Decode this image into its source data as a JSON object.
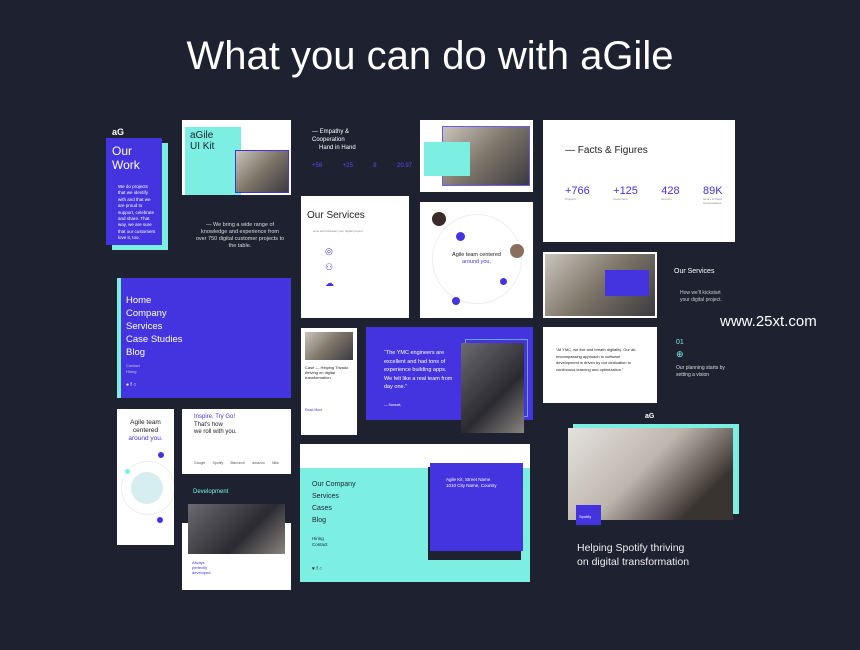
{
  "title": "What you can do with aGile",
  "watermark": "www.25xt.com",
  "our_work": {
    "logo": "aG",
    "heading": "Our Work",
    "body": "We do projects that we identify with and that we are proud to support, celebrate and share. That way, we are sure that our customers love it, too."
  },
  "ui_kit": {
    "logo": "aG",
    "heading_1": "aGile",
    "heading_2": "UI Kit"
  },
  "empathy": {
    "line1": "— Empathy &",
    "line2": "Cooperation",
    "line3": "Hand in Hand",
    "stats": [
      "+56",
      "+25",
      "8",
      "20.97"
    ]
  },
  "bring": {
    "text": "— We bring a wide range of knowledge and experience from over 750 digital customer projects to the table."
  },
  "our_services_card": {
    "heading": "Our Services",
    "sub": "How we'll kickstart your digital project."
  },
  "facts": {
    "heading": "— Facts & Figures",
    "items": [
      {
        "value": "+766",
        "label": "Projects"
      },
      {
        "value": "+125",
        "label": "Customers"
      },
      {
        "value": "428",
        "label": "Servers"
      },
      {
        "value": "89K",
        "label": "Hours of client conversations"
      }
    ]
  },
  "team_circle": {
    "line1": "Agile team centered",
    "line2": "around you."
  },
  "services_side": {
    "heading": "Our Services",
    "line1": "How we'll kickstart",
    "line2": "your digital project."
  },
  "menu": {
    "items": [
      "Home",
      "Company",
      "Services",
      "Case Studies",
      "Blog"
    ],
    "small": [
      "Contact",
      "Hiring"
    ]
  },
  "case": {
    "title": "Case — Helping Trivado thriving on digital transformation",
    "link": "Read More"
  },
  "quote": {
    "text": "“The YMC engineers are excellent and had tons of experience building apps. We felt like a real team from day one.”",
    "author": "— Samuel,"
  },
  "ymc": {
    "text": "“At YMC, we live and breath digitality. Our all-encompassing approach to software development is driven by our dedication to continuous learning and optimization.”"
  },
  "step": {
    "number": "01",
    "text": "Our planning starts by setting a vision"
  },
  "phone": {
    "line1": "Agile team",
    "line2": "centered",
    "line3": "around you."
  },
  "inspire": {
    "line1": "Inspire, Try Go!",
    "line2": "That's how",
    "line3": "we roll with you.",
    "logos": [
      "Google",
      "Spotify",
      "Bitcrunch",
      "amazon",
      "Nike"
    ]
  },
  "development": {
    "label": "Development",
    "heading": "Always perfectly developed"
  },
  "footer": {
    "nav": [
      "Our Company",
      "Services",
      "Cases",
      "Blog"
    ],
    "small": [
      "Hiring",
      "Contact"
    ],
    "address1": "Agile Kit, Street Name",
    "address2": "1010 City Name, Country"
  },
  "spotify": {
    "logo": "aG",
    "badge": "Spotify",
    "line1": "Helping Spotify thriving",
    "line2": "on digital transformation"
  },
  "colors": {
    "bg": "#1e2130",
    "purple": "#4434e0",
    "teal": "#7deee2"
  }
}
